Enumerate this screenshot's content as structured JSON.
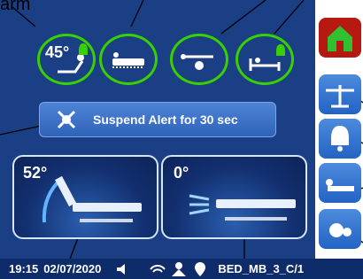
{
  "top_label": "arm",
  "alarm_icons": [
    {
      "name": "hob-angle-alarm",
      "label": "45°",
      "icon": "patient-incline-icon",
      "bell": true
    },
    {
      "name": "mattress-alarm",
      "icon": "mattress-icon",
      "bell": false
    },
    {
      "name": "fan-alarm",
      "icon": "fan-patient-icon",
      "bell": false
    },
    {
      "name": "bed-exit-alarm",
      "icon": "bed-exit-icon",
      "bell": true
    }
  ],
  "suspend": {
    "label": "Suspend Alert for 30 sec",
    "icon": "suspend-alert-icon"
  },
  "panels": [
    {
      "name": "head-angle-panel",
      "value": "52°"
    },
    {
      "name": "tilt-angle-panel",
      "value": "0°"
    }
  ],
  "status": {
    "time": "19:15",
    "date": "02/07/2020",
    "bed_id": "BED_MB_3_C/1",
    "icons": [
      "speaker-icon",
      "wifi-icon",
      "nurse-icon",
      "location-icon"
    ]
  },
  "sidebar": [
    {
      "name": "home-button",
      "icon": "home-icon"
    },
    {
      "name": "scale-button",
      "icon": "scale-icon"
    },
    {
      "name": "alarm-button",
      "icon": "bell-icon"
    },
    {
      "name": "bed-button",
      "icon": "bed-icon"
    },
    {
      "name": "settings-button",
      "icon": "gear-icon"
    }
  ],
  "colors": {
    "screen_bg": "#1a3f85",
    "ring": "#39d000",
    "home": "#b61812",
    "button": "#3572cc",
    "status_bg": "#0f2c6a"
  }
}
